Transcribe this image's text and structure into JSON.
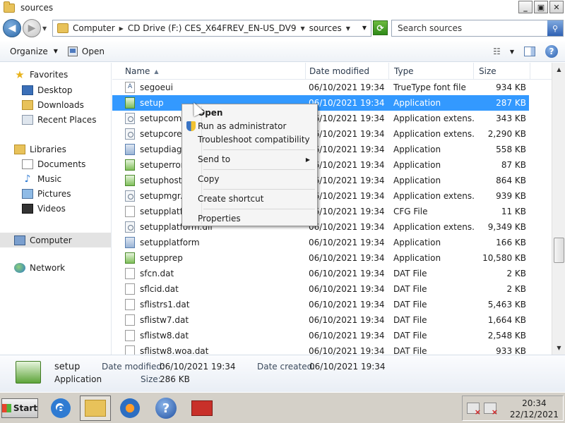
{
  "window": {
    "title": "sources",
    "minimize": "_",
    "maximize": "▣",
    "close": "✕"
  },
  "address": {
    "crumbs": [
      "Computer",
      "CD Drive (F:) CES_X64FREV_EN-US_DV9",
      "sources"
    ],
    "search_placeholder": "Search sources"
  },
  "toolbar": {
    "organize": "Organize",
    "open": "Open"
  },
  "nav": {
    "favorites": "Favorites",
    "desktop": "Desktop",
    "downloads": "Downloads",
    "recent": "Recent Places",
    "libraries": "Libraries",
    "documents": "Documents",
    "music": "Music",
    "pictures": "Pictures",
    "videos": "Videos",
    "computer": "Computer",
    "network": "Network"
  },
  "columns": {
    "name": "Name",
    "date": "Date modified",
    "type": "Type",
    "size": "Size"
  },
  "files": [
    {
      "name": "segoeui",
      "date": "06/10/2021 19:34",
      "type": "TrueType font file",
      "size": "934 KB",
      "icon": "font"
    },
    {
      "name": "setup",
      "date": "06/10/2021 19:34",
      "type": "Application",
      "size": "287 KB",
      "icon": "app"
    },
    {
      "name": "setupcomp",
      "date": "06/10/2021 19:34",
      "type": "Application extens...",
      "size": "343 KB",
      "icon": "dll"
    },
    {
      "name": "setupcore.d",
      "date": "06/10/2021 19:34",
      "type": "Application extens...",
      "size": "2,290 KB",
      "icon": "dll"
    },
    {
      "name": "setupdiag",
      "date": "06/10/2021 19:34",
      "type": "Application",
      "size": "558 KB",
      "icon": "diag"
    },
    {
      "name": "setuperror",
      "date": "06/10/2021 19:34",
      "type": "Application",
      "size": "87 KB",
      "icon": "app"
    },
    {
      "name": "setuphost",
      "date": "06/10/2021 19:34",
      "type": "Application",
      "size": "864 KB",
      "icon": "app"
    },
    {
      "name": "setupmgr.d",
      "date": "06/10/2021 19:34",
      "type": "Application extens...",
      "size": "939 KB",
      "icon": "dll"
    },
    {
      "name": "setupplatfo",
      "date": "06/10/2021 19:34",
      "type": "CFG File",
      "size": "11 KB",
      "icon": "file"
    },
    {
      "name": "setupplatform.dll",
      "date": "06/10/2021 19:34",
      "type": "Application extens...",
      "size": "9,349 KB",
      "icon": "dll"
    },
    {
      "name": "setupplatform",
      "date": "06/10/2021 19:34",
      "type": "Application",
      "size": "166 KB",
      "icon": "diag"
    },
    {
      "name": "setupprep",
      "date": "06/10/2021 19:34",
      "type": "Application",
      "size": "10,580 KB",
      "icon": "app"
    },
    {
      "name": "sfcn.dat",
      "date": "06/10/2021 19:34",
      "type": "DAT File",
      "size": "2 KB",
      "icon": "file"
    },
    {
      "name": "sflcid.dat",
      "date": "06/10/2021 19:34",
      "type": "DAT File",
      "size": "2 KB",
      "icon": "file"
    },
    {
      "name": "sflistrs1.dat",
      "date": "06/10/2021 19:34",
      "type": "DAT File",
      "size": "5,463 KB",
      "icon": "file"
    },
    {
      "name": "sflistw7.dat",
      "date": "06/10/2021 19:34",
      "type": "DAT File",
      "size": "1,664 KB",
      "icon": "file"
    },
    {
      "name": "sflistw8.dat",
      "date": "06/10/2021 19:34",
      "type": "DAT File",
      "size": "2,548 KB",
      "icon": "file"
    },
    {
      "name": "sflistw8.woa.dat",
      "date": "06/10/2021 19:34",
      "type": "DAT File",
      "size": "933 KB",
      "icon": "file"
    }
  ],
  "context_menu": {
    "open": "Open",
    "run_as_admin": "Run as administrator",
    "troubleshoot": "Troubleshoot compatibility",
    "send_to": "Send to",
    "copy": "Copy",
    "create_shortcut": "Create shortcut",
    "properties": "Properties"
  },
  "details": {
    "name": "setup",
    "type": "Application",
    "modified_label": "Date modified:",
    "modified_value": "06/10/2021 19:34",
    "created_label": "Date created:",
    "created_value": "06/10/2021 19:34",
    "size_label": "Size:",
    "size_value": "286 KB"
  },
  "taskbar": {
    "start": "Start",
    "time": "20:34",
    "date": "22/12/2021"
  },
  "colors": {
    "selection": "#3399ff",
    "taskbar": "#d4d0c8"
  }
}
